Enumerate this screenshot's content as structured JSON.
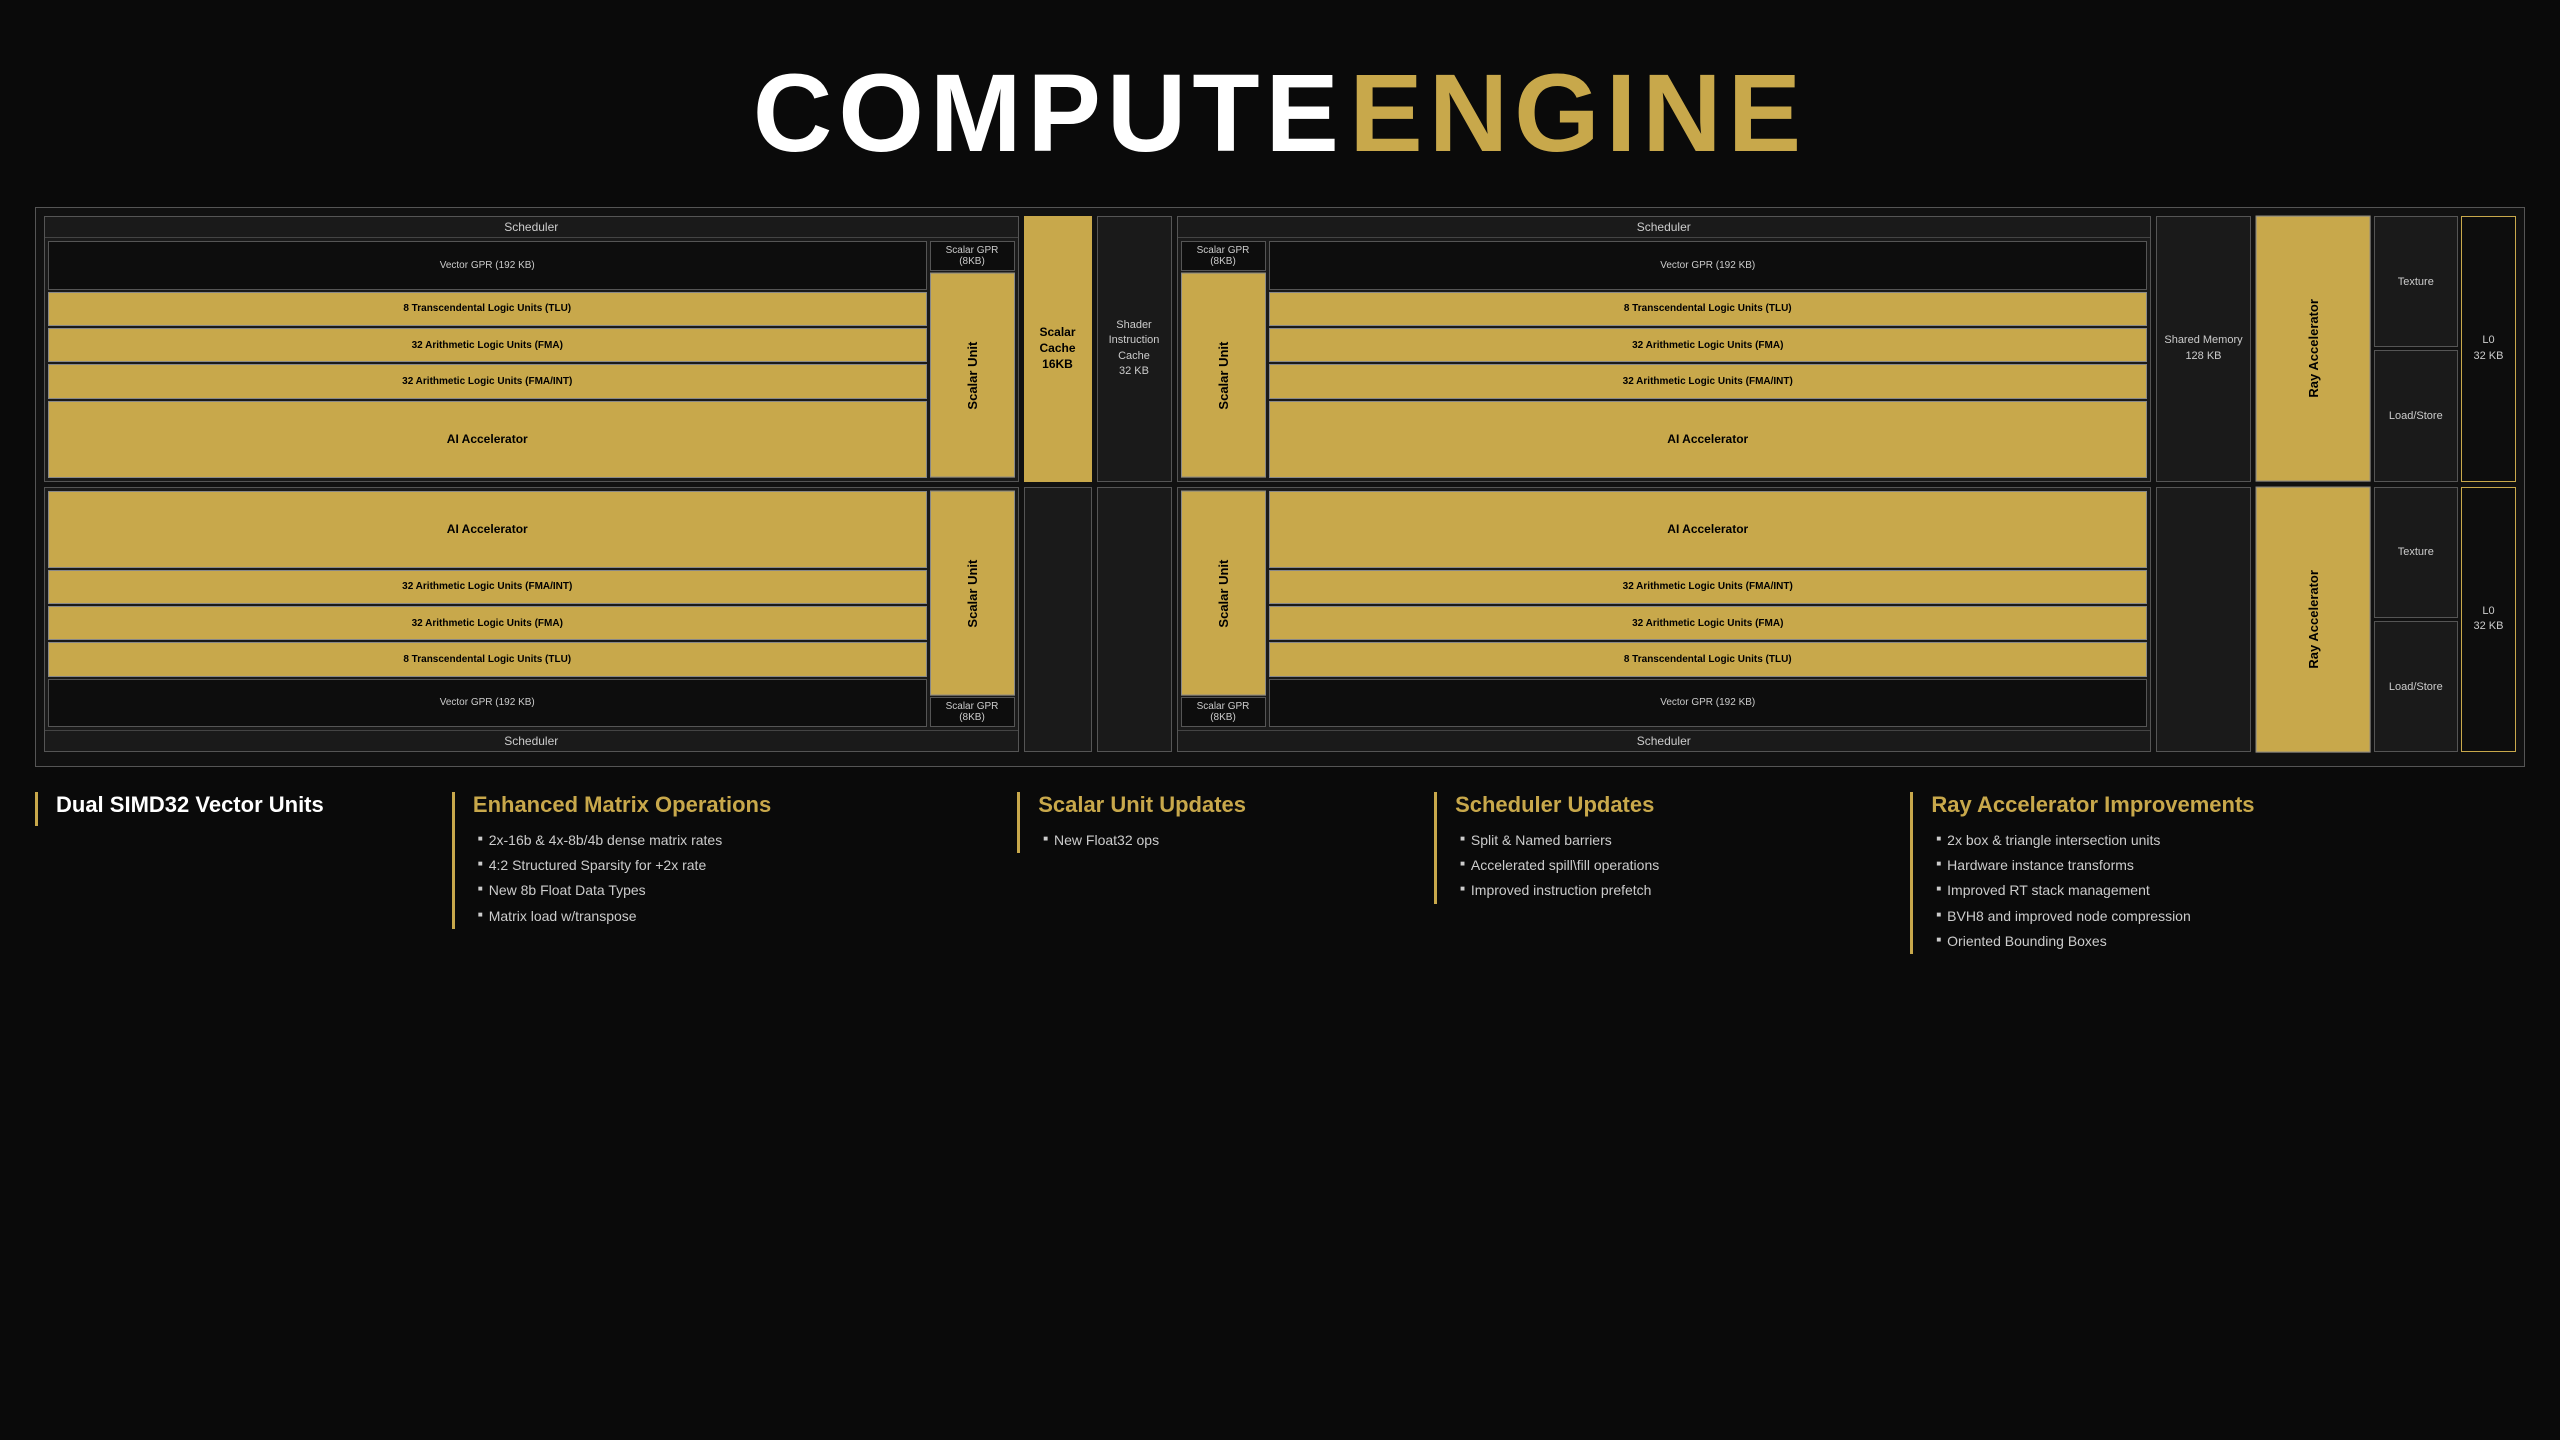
{
  "title": {
    "part1": "COMPUTE",
    "part2": "ENGINE"
  },
  "diagram": {
    "top_row": {
      "scheduler1_label": "Scheduler",
      "vector_gpr_label": "Vector GPR\n(192 KB)",
      "scalar_gpr_1": "Scalar GPR (8KB)",
      "tlu_1": "8 Transcendental Logic Units (TLU)",
      "fma_1": "32 Arithmetic Logic Units (FMA)",
      "fma_int_1": "32 Arithmetic Logic Units (FMA/INT)",
      "ai_accel_1": "AI Accelerator",
      "scalar_unit_1": "Scalar Unit",
      "scalar_cache": "Scalar Cache\n16KB",
      "shader_cache": "Shader\nInstruction\nCache\n32 KB",
      "scheduler2_label": "Scheduler",
      "scalar_gpr_2": "Scalar GPR (8KB)",
      "vector_gpr_2": "Vector GPR\n(192 KB)",
      "tlu_2": "8 Transcendental Logic Units (TLU)",
      "fma_2": "32 Arithmetic Logic Units (FMA)",
      "fma_int_2": "32 Arithmetic Logic Units (FMA/INT)",
      "ai_accel_2": "AI Accelerator",
      "scalar_unit_2": "Scalar Unit",
      "shared_mem": "Shared Memory\n128 KB",
      "ray_accel_1": "Ray Accelerator",
      "texture_1": "Texture",
      "load_store_1": "Load/Store",
      "lo_1": "L0\n32 KB"
    },
    "bottom_row": {
      "ai_accel_b1": "AI Accelerator",
      "fma_int_b1": "32 Arithmetic Logic Units (FMA/INT)",
      "fma_b1": "32 Arithmetic Logic Units (FMA)",
      "tlu_b1": "8 Transcendental Logic Units (TLU)",
      "vector_gpr_b1": "Vector GPR\n(192 KB)",
      "scalar_gpr_b1": "Scalar GPR (8KB)",
      "scheduler_b1": "Scheduler",
      "scalar_unit_b1": "Scalar Unit",
      "scalar_unit_b2": "Scalar Unit",
      "ai_accel_b2": "AI Accelerator",
      "fma_int_b2": "32 Arithmetic Logic Units (FMA/INT)",
      "fma_b2": "32 Arithmetic Logic Units (FMA)",
      "tlu_b2": "8 Transcendental Logic Units (TLU)",
      "vector_gpr_b2": "Vector GPR\n(192 KB)",
      "scalar_gpr_b2": "Scalar GPR (8KB)",
      "scheduler_b2": "Scheduler",
      "ray_accel_2": "Ray Accelerator",
      "texture_2": "Texture",
      "load_store_2": "Load/Store",
      "lo_2": "L0\n32 KB"
    }
  },
  "annotations": {
    "simd": {
      "title": "Dual SIMD32 Vector Units",
      "title_color": "white"
    },
    "matrix": {
      "title": "Enhanced Matrix Operations",
      "items": [
        "2x-16b & 4x-8b/4b dense matrix rates",
        "4:2 Structured Sparsity for +2x rate",
        "New 8b Float Data Types",
        "Matrix load w/transpose"
      ]
    },
    "scalar": {
      "title": "Scalar Unit Updates",
      "items": [
        "New Float32 ops"
      ]
    },
    "scheduler": {
      "title": "Scheduler Updates",
      "items": [
        "Split & Named barriers",
        "Accelerated spill\\fill operations",
        "Improved instruction prefetch"
      ]
    },
    "ray": {
      "title": "Ray Accelerator Improvements",
      "items": [
        "2x box & triangle intersection units",
        "Hardware instance transforms",
        "Improved RT stack management",
        "BVH8 and improved node compression",
        "Oriented Bounding Boxes"
      ]
    }
  }
}
